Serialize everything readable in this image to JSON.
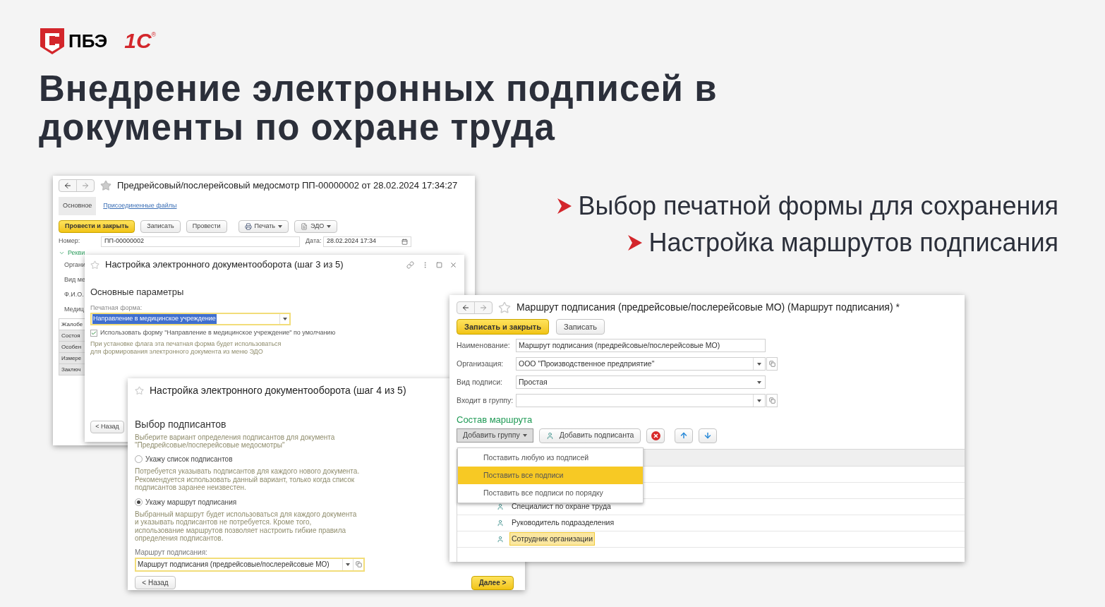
{
  "logos": {
    "company": "ПБЭ",
    "platform": "1С",
    "registered": "®"
  },
  "title_lines": [
    "Внедрение электронных подписей в",
    "документы по охране труда"
  ],
  "bullets": [
    "Выбор печатной формы для сохранения",
    "Настройка маршрутов подписания"
  ],
  "window_doc": {
    "title": "Предрейсовый/послерейсовый медосмотр ПП-00000002 от 28.02.2024 17:34:27",
    "tabs": [
      {
        "label": "Основное",
        "selected": true
      },
      {
        "label": "Присоединенные файлы",
        "selected": false
      }
    ],
    "buttons": [
      {
        "label": "Провести и закрыть",
        "kind": "primary"
      },
      {
        "label": "Записать",
        "kind": "plain"
      },
      {
        "label": "Провести",
        "kind": "plain"
      },
      {
        "label": "Печать",
        "kind": "print"
      },
      {
        "label": "ЭДО",
        "kind": "edo"
      }
    ],
    "number_label": "Номер:",
    "number_value": "ПП-00000002",
    "date_label": "Дата:",
    "date_value": "28.02.2024 17:34",
    "group": "Рекви",
    "field_labels": [
      "Органи",
      "Вид ме",
      "Ф.И.О.",
      "Медиц"
    ],
    "side_tabs": [
      {
        "label": "Жалобе",
        "selected": true
      },
      {
        "label": "Состоя",
        "selected": false
      },
      {
        "label": "Особен",
        "selected": false
      },
      {
        "label": "Измере",
        "selected": false
      },
      {
        "label": "Заключ",
        "selected": false
      }
    ]
  },
  "window_step3": {
    "title": "Настройка электронного документооборота (шаг 3 из 5)",
    "heading": "Основные параметры",
    "field_label": "Печатная форма:",
    "field_value": "Направление в медицинское учреждение",
    "use_default": {
      "label": "Использовать форму \"Направление в медицинское учреждение\" по умолчанию",
      "checked": true
    },
    "hint": [
      "При установке флага эта печатная форма будет использоваться",
      "для формирования электронного документа из меню ЭДО"
    ],
    "back": "< Назад"
  },
  "window_step4": {
    "title": "Настройка электронного документооборота (шаг 4 из 5)",
    "heading": "Выбор подписантов",
    "description": [
      "Выберите вариант определения подписантов для документа",
      "\"Предрейсовые/посперейсовые медосмотры\""
    ],
    "options": [
      {
        "label": "Укажу список подписантов",
        "selected": false,
        "hint": [
          "Потребуется указывать подписантов для каждого нового документа.",
          "Рекомендуется использовать данный вариант, только когда список",
          "подписантов заранее неизвестен."
        ]
      },
      {
        "label": "Укажу маршрут подписания",
        "selected": true,
        "hint": [
          "Выбранный маршрут будет использоваться для каждого документа",
          "и указывать подписантов не потребуется. Кроме того,",
          "использование маршрутов позволяет настроить гибкие правила",
          "определения подписантов."
        ]
      }
    ],
    "route_label": "Маршрут подписания:",
    "route_value": "Маршрут подписания (предрейсовые/послерейсовые МО)",
    "back": "< Назад",
    "next": "Далее >"
  },
  "window_route": {
    "title": "Маршрут подписания (предрейсовые/послерейсовые МО) (Маршрут подписания) *",
    "buttons": [
      {
        "label": "Записать и закрыть",
        "kind": "primary"
      },
      {
        "label": "Записать",
        "kind": "plain"
      }
    ],
    "fields": [
      {
        "label": "Наименование:",
        "value": "Маршрут подписания (предрейсовые/послерейсовые МО)",
        "kind": "text"
      },
      {
        "label": "Организация:",
        "value": "ООО \"Производственное предприятие\"",
        "kind": "ref"
      },
      {
        "label": "Вид подписи:",
        "value": "Простая",
        "kind": "select"
      },
      {
        "label": "Входит в группу:",
        "kind": "ref"
      }
    ],
    "section": "Состав маршрута",
    "add_group": "Добавить группу",
    "add_signer": "Добавить подписанта",
    "menu": [
      {
        "label": "Поставить любую из подписей",
        "selected": false
      },
      {
        "label": "Поставить все подписи",
        "selected": true
      },
      {
        "label": "Поставить все подписи по порядку",
        "selected": false
      }
    ],
    "rows": [
      {
        "label": "Специалист по охране труда",
        "selected": false
      },
      {
        "label": "Руководитель подразделения",
        "selected": false
      },
      {
        "label": "Сотрудник организации",
        "selected": true
      }
    ]
  }
}
